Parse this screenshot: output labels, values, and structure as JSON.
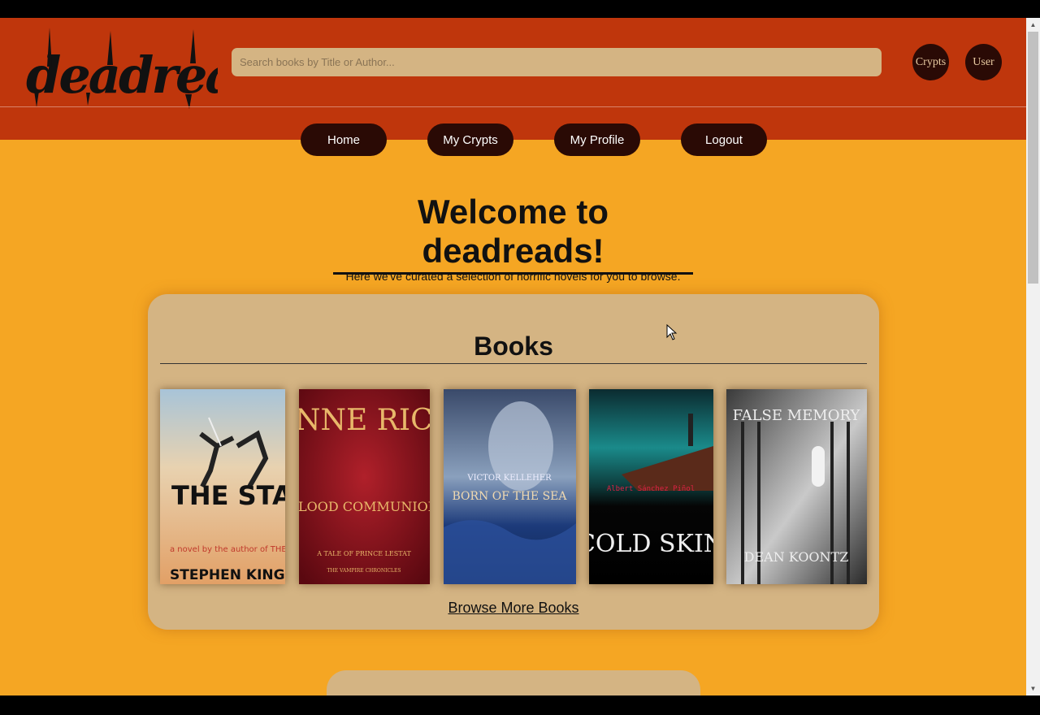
{
  "header": {
    "logo_text": "deadreads",
    "search_placeholder": "Search books by Title or Author...",
    "crypts_button": "Crypts",
    "user_button": "User"
  },
  "nav": {
    "home": "Home",
    "my_crypts": "My Crypts",
    "my_profile": "My Profile",
    "logout": "Logout"
  },
  "main": {
    "welcome_title": "Welcome to deadreads!",
    "intro_text": "Here we've curated a selection of horrific novels for you to browse.",
    "books_heading": "Books",
    "browse_more": "Browse More Books"
  },
  "books": [
    {
      "title": "THE STAND",
      "author": "STEPHEN KING",
      "tagline": "a novel by the author of THE SHINING"
    },
    {
      "title": "BLOOD COMMUNION",
      "author": "ANNE RICE",
      "tagline": "A TALE OF PRINCE LESTAT",
      "series": "THE VAMPIRE CHRONICLES"
    },
    {
      "title": "BORN OF THE SEA",
      "author": "VICTOR KELLEHER"
    },
    {
      "title": "COLD SKIN",
      "author": "Albert Sánchez Piñol"
    },
    {
      "title": "FALSE MEMORY",
      "author": "DEAN KOONTZ"
    }
  ],
  "colors": {
    "page_background": "#f5a623",
    "header_background": "#bf360c",
    "panel_background": "#d4b483",
    "button_background": "#2a0a05"
  }
}
